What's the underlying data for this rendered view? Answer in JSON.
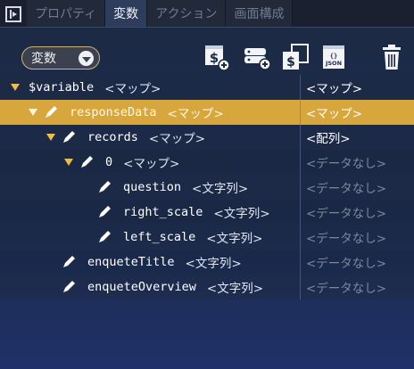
{
  "tabs": [
    {
      "label": "プロパティ",
      "active": false
    },
    {
      "label": "変数",
      "active": true
    },
    {
      "label": "アクション",
      "active": false
    },
    {
      "label": "画面構成",
      "active": false
    }
  ],
  "toolbar": {
    "scope_dropdown": "変数",
    "buttons": [
      {
        "icon": "add-dollar-variable-icon"
      },
      {
        "icon": "add-database-icon"
      },
      {
        "icon": "copy-dollar-icon"
      },
      {
        "icon": "json-file-icon",
        "label": "JSON"
      },
      {
        "icon": "trash-icon"
      }
    ]
  },
  "tree": [
    {
      "name": "$variable",
      "type": "<マップ>",
      "value": "<マップ>",
      "value_muted": false,
      "expanded": true,
      "pen": false,
      "selected": false
    },
    {
      "name": "responseData",
      "type": "<マップ>",
      "value": "<マップ>",
      "value_muted": false,
      "expanded": true,
      "pen": true,
      "selected": true
    },
    {
      "name": "records",
      "type": "<マップ>",
      "value": "<配列>",
      "value_muted": false,
      "expanded": true,
      "pen": true,
      "selected": false
    },
    {
      "name": "0",
      "type": "<マップ>",
      "value": "<データなし>",
      "value_muted": true,
      "expanded": true,
      "pen": true,
      "selected": false
    },
    {
      "name": "question",
      "type": "<文字列>",
      "value": "<データなし>",
      "value_muted": true,
      "expanded": false,
      "pen": true,
      "selected": false
    },
    {
      "name": "right_scale",
      "type": "<文字列>",
      "value": "<データなし>",
      "value_muted": true,
      "expanded": false,
      "pen": true,
      "selected": false
    },
    {
      "name": "left_scale",
      "type": "<文字列>",
      "value": "<データなし>",
      "value_muted": true,
      "expanded": false,
      "pen": true,
      "selected": false
    },
    {
      "name": "enqueteTitle",
      "type": "<文字列>",
      "value": "<データなし>",
      "value_muted": true,
      "expanded": false,
      "pen": true,
      "selected": false
    },
    {
      "name": "enqueteOverview",
      "type": "<文字列>",
      "value": "<データなし>",
      "value_muted": true,
      "expanded": false,
      "pen": true,
      "selected": false
    }
  ],
  "colors": {
    "selected_row": "#d7a73e",
    "expand_arrow": "#e8bd55",
    "muted_value": "#7c879c"
  }
}
